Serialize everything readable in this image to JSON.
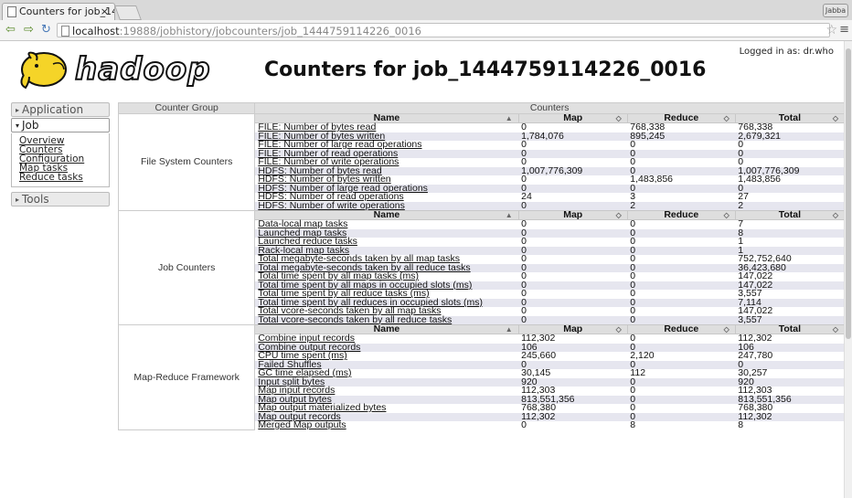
{
  "browser": {
    "tab_title": "Counters for job_14",
    "tab_close": "×",
    "url_host": "localhost",
    "url_rest": ":19888/jobhistory/jobcounters/job_1444759114226_0016",
    "window_label": "Jabba"
  },
  "header": {
    "logo_text": "hadoop",
    "title": "Counters for job_1444759114226_0016",
    "logged_in": "Logged in as: dr.who"
  },
  "sidebar": {
    "application": "Application",
    "job": "Job",
    "job_links": [
      "Overview",
      "Counters",
      "Configuration",
      "Map tasks",
      "Reduce tasks"
    ],
    "tools": "Tools"
  },
  "table": {
    "col_group": "Counter Group",
    "col_counters": "Counters",
    "sub_headers": [
      "Name",
      "Map",
      "Reduce",
      "Total"
    ],
    "groups": [
      {
        "name": "File System Counters",
        "rows": [
          [
            "FILE: Number of bytes read",
            "0",
            "768,338",
            "768,338"
          ],
          [
            "FILE: Number of bytes written",
            "1,784,076",
            "895,245",
            "2,679,321"
          ],
          [
            "FILE: Number of large read operations",
            "0",
            "0",
            "0"
          ],
          [
            "FILE: Number of read operations",
            "0",
            "0",
            "0"
          ],
          [
            "FILE: Number of write operations",
            "0",
            "0",
            "0"
          ],
          [
            "HDFS: Number of bytes read",
            "1,007,776,309",
            "0",
            "1,007,776,309"
          ],
          [
            "HDFS: Number of bytes written",
            "0",
            "1,483,856",
            "1,483,856"
          ],
          [
            "HDFS: Number of large read operations",
            "0",
            "0",
            "0"
          ],
          [
            "HDFS: Number of read operations",
            "24",
            "3",
            "27"
          ],
          [
            "HDFS: Number of write operations",
            "0",
            "2",
            "2"
          ]
        ]
      },
      {
        "name": "Job Counters",
        "rows": [
          [
            "Data-local map tasks",
            "0",
            "0",
            "7"
          ],
          [
            "Launched map tasks",
            "0",
            "0",
            "8"
          ],
          [
            "Launched reduce tasks",
            "0",
            "0",
            "1"
          ],
          [
            "Rack-local map tasks",
            "0",
            "0",
            "1"
          ],
          [
            "Total megabyte-seconds taken by all map tasks",
            "0",
            "0",
            "752,752,640"
          ],
          [
            "Total megabyte-seconds taken by all reduce tasks",
            "0",
            "0",
            "36,423,680"
          ],
          [
            "Total time spent by all map tasks (ms)",
            "0",
            "0",
            "147,022"
          ],
          [
            "Total time spent by all maps in occupied slots (ms)",
            "0",
            "0",
            "147,022"
          ],
          [
            "Total time spent by all reduce tasks (ms)",
            "0",
            "0",
            "3,557"
          ],
          [
            "Total time spent by all reduces in occupied slots (ms)",
            "0",
            "0",
            "7,114"
          ],
          [
            "Total vcore-seconds taken by all map tasks",
            "0",
            "0",
            "147,022"
          ],
          [
            "Total vcore-seconds taken by all reduce tasks",
            "0",
            "0",
            "3,557"
          ]
        ]
      },
      {
        "name": "Map-Reduce Framework",
        "rows": [
          [
            "Combine input records",
            "112,302",
            "0",
            "112,302"
          ],
          [
            "Combine output records",
            "106",
            "0",
            "106"
          ],
          [
            "CPU time spent (ms)",
            "245,660",
            "2,120",
            "247,780"
          ],
          [
            "Failed Shuffles",
            "0",
            "0",
            "0"
          ],
          [
            "GC time elapsed (ms)",
            "30,145",
            "112",
            "30,257"
          ],
          [
            "Input split bytes",
            "920",
            "0",
            "920"
          ],
          [
            "Map input records",
            "112,303",
            "0",
            "112,303"
          ],
          [
            "Map output bytes",
            "813,551,356",
            "0",
            "813,551,356"
          ],
          [
            "Map output materialized bytes",
            "768,380",
            "0",
            "768,380"
          ],
          [
            "Map output records",
            "112,302",
            "0",
            "112,302"
          ],
          [
            "Merged Map outputs",
            "0",
            "8",
            "8"
          ]
        ]
      }
    ]
  }
}
